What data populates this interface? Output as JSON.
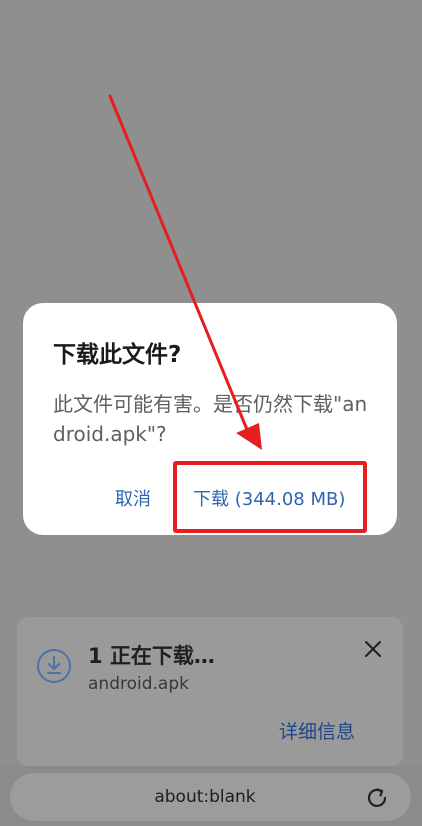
{
  "dialog": {
    "title": "下载此文件?",
    "message": "此文件可能有害。是否仍然下载\"android.apk\"?",
    "cancel_label": "取消",
    "download_label": "下载 (344.08 MB)"
  },
  "notification": {
    "status": "1 正在下载…",
    "filename": "android.apk",
    "details_label": "详细信息",
    "icon": "download-icon",
    "close_icon": "close-icon"
  },
  "address_bar": {
    "url": "about:blank",
    "reload_icon": "reload-icon"
  },
  "colors": {
    "accent": "#2f65b1",
    "annotation": "#e51f1f",
    "overlay": "#8f8f8f"
  }
}
